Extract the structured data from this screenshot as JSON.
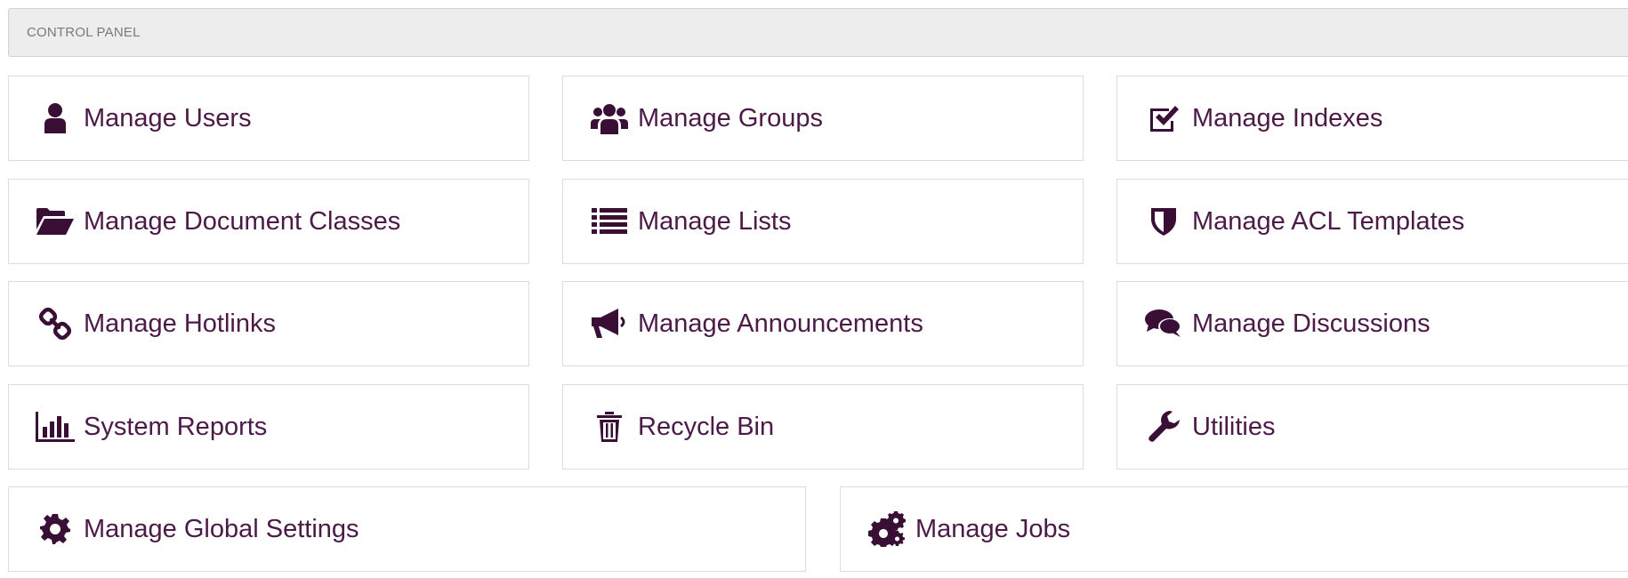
{
  "header": {
    "title": "CONTROL PANEL"
  },
  "tiles": {
    "manage_users": {
      "label": "Manage Users",
      "icon": "user-icon"
    },
    "manage_groups": {
      "label": "Manage Groups",
      "icon": "users-icon"
    },
    "manage_indexes": {
      "label": "Manage Indexes",
      "icon": "check-square-icon"
    },
    "manage_document_classes": {
      "label": "Manage Document Classes",
      "icon": "folder-open-icon"
    },
    "manage_lists": {
      "label": "Manage Lists",
      "icon": "list-icon"
    },
    "manage_acl_templates": {
      "label": "Manage ACL Templates",
      "icon": "shield-icon"
    },
    "manage_hotlinks": {
      "label": "Manage Hotlinks",
      "icon": "chain-link-icon"
    },
    "manage_announcements": {
      "label": "Manage Announcements",
      "icon": "megaphone-icon"
    },
    "manage_discussions": {
      "label": "Manage Discussions",
      "icon": "comments-icon"
    },
    "system_reports": {
      "label": "System Reports",
      "icon": "bar-chart-icon"
    },
    "recycle_bin": {
      "label": "Recycle Bin",
      "icon": "trash-icon"
    },
    "utilities": {
      "label": "Utilities",
      "icon": "wrench-icon"
    },
    "manage_global_settings": {
      "label": "Manage Global Settings",
      "icon": "gear-icon"
    },
    "manage_jobs": {
      "label": "Manage Jobs",
      "icon": "gears-icon"
    }
  },
  "colors": {
    "icon": "#3a0f36",
    "label": "#4b1a47",
    "header_bg": "#ededed",
    "header_text": "#7a7a7a",
    "tile_border": "#dcdcdc"
  }
}
